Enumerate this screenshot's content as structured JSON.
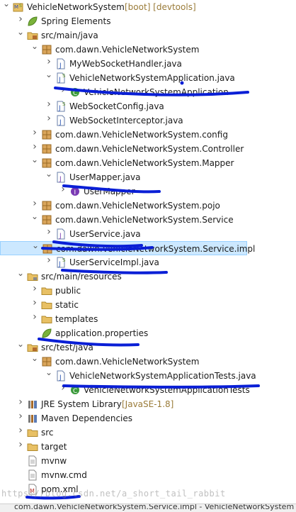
{
  "tree": [
    {
      "depth": 0,
      "expander": "down",
      "icon": "maven-boot-project-icon",
      "label": "VehicleNetworkSystem",
      "decor": " [boot] [devtools]"
    },
    {
      "depth": 1,
      "expander": "right",
      "icon": "spring-leaf-icon",
      "label": "Spring Elements"
    },
    {
      "depth": 1,
      "expander": "down",
      "icon": "source-folder-icon",
      "label": "src/main/java"
    },
    {
      "depth": 2,
      "expander": "down",
      "icon": "package-icon",
      "label": "com.dawn.VehicleNetworkSystem"
    },
    {
      "depth": 3,
      "expander": "right",
      "icon": "java-file-icon",
      "label": "MyWebSocketHandler.java"
    },
    {
      "depth": 3,
      "expander": "down",
      "icon": "spring-java-file-icon",
      "label": "VehicleNetworkSystemApplication.java"
    },
    {
      "depth": 4,
      "expander": "right",
      "icon": "spring-class-icon",
      "label": "VehicleNetworkSystemApplication"
    },
    {
      "depth": 3,
      "expander": "right",
      "icon": "spring-java-file-icon",
      "label": "WebSocketConfig.java"
    },
    {
      "depth": 3,
      "expander": "right",
      "icon": "java-file-icon",
      "label": "WebSocketInterceptor.java"
    },
    {
      "depth": 2,
      "expander": "right",
      "icon": "package-icon",
      "label": "com.dawn.VehicleNetworkSystem.config"
    },
    {
      "depth": 2,
      "expander": "right",
      "icon": "package-icon",
      "label": "com.dawn.VehicleNetworkSystem.Controller"
    },
    {
      "depth": 2,
      "expander": "down",
      "icon": "package-icon",
      "label": "com.dawn.VehicleNetworkSystem.Mapper"
    },
    {
      "depth": 3,
      "expander": "down",
      "icon": "interface-file-icon",
      "label": "UserMapper.java"
    },
    {
      "depth": 4,
      "expander": "right",
      "icon": "interface-icon",
      "label": "UserMapper"
    },
    {
      "depth": 2,
      "expander": "right",
      "icon": "package-icon",
      "label": "com.dawn.VehicleNetworkSystem.pojo"
    },
    {
      "depth": 2,
      "expander": "down",
      "icon": "package-icon",
      "label": "com.dawn.VehicleNetworkSystem.Service"
    },
    {
      "depth": 3,
      "expander": "right",
      "icon": "interface-file-icon",
      "label": "UserService.java"
    },
    {
      "depth": 2,
      "expander": "down",
      "icon": "package-icon",
      "label": "com.dawn.VehicleNetworkSystem.Service.impl",
      "selected": true
    },
    {
      "depth": 3,
      "expander": "right",
      "icon": "spring-java-file-icon",
      "label": "UserServiceImpl.java"
    },
    {
      "depth": 1,
      "expander": "down",
      "icon": "resource-folder-icon",
      "label": "src/main/resources"
    },
    {
      "depth": 2,
      "expander": "right",
      "icon": "folder-icon",
      "label": "public"
    },
    {
      "depth": 2,
      "expander": "right",
      "icon": "folder-icon",
      "label": "static"
    },
    {
      "depth": 2,
      "expander": "right",
      "icon": "folder-icon",
      "label": "templates"
    },
    {
      "depth": 2,
      "expander": "none",
      "icon": "spring-properties-icon",
      "label": "application.properties"
    },
    {
      "depth": 1,
      "expander": "down",
      "icon": "source-folder-icon",
      "label": "src/test/java"
    },
    {
      "depth": 2,
      "expander": "down",
      "icon": "package-icon",
      "label": "com.dawn.VehicleNetworkSystem"
    },
    {
      "depth": 3,
      "expander": "down",
      "icon": "java-file-icon",
      "label": "VehicleNetworkSystemApplicationTests.java"
    },
    {
      "depth": 4,
      "expander": "right",
      "icon": "test-class-icon",
      "label": "VehicleNetworkSystemApplicationTests"
    },
    {
      "depth": 1,
      "expander": "right",
      "icon": "library-icon",
      "label": "JRE System Library",
      "decor": " [JavaSE-1.8]"
    },
    {
      "depth": 1,
      "expander": "right",
      "icon": "library-icon",
      "label": "Maven Dependencies"
    },
    {
      "depth": 1,
      "expander": "right",
      "icon": "folder-icon",
      "label": "src"
    },
    {
      "depth": 1,
      "expander": "right",
      "icon": "folder-icon",
      "label": "target"
    },
    {
      "depth": 1,
      "expander": "none",
      "icon": "file-icon",
      "label": "mvnw"
    },
    {
      "depth": 1,
      "expander": "none",
      "icon": "file-icon",
      "label": "mvnw.cmd"
    },
    {
      "depth": 1,
      "expander": "none",
      "icon": "maven-pom-icon",
      "label": "pom.xml"
    }
  ],
  "watermark": "https://blog.csdn.net/a_short_tail_rabbit",
  "statusbar": "com.dawn.VehicleNetworkSystem.Service.impl - VehicleNetworkSystem",
  "colors": {
    "annotation": "#0a1fd6",
    "selection": "#cce8ff",
    "package": "#b8762a",
    "decoration": "#9a7b38"
  }
}
